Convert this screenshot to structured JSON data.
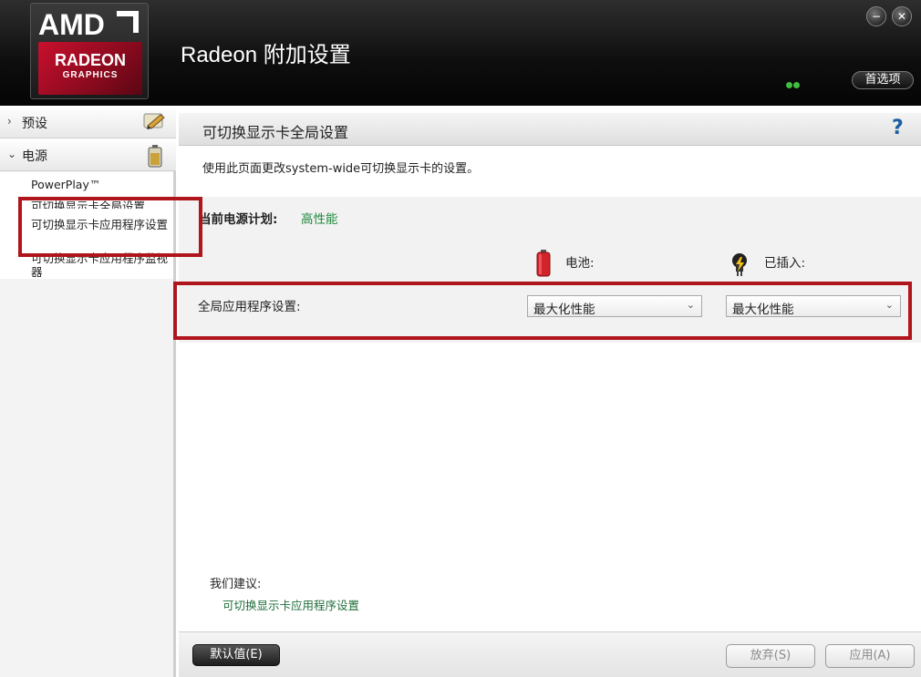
{
  "header": {
    "logo": {
      "brand": "AMD",
      "product": "RADEON",
      "sub": "GRAPHICS"
    },
    "title": "Radeon 附加设置",
    "window_controls": {
      "minimize": "−",
      "close": "✕"
    },
    "preferences_label": "首选项"
  },
  "sidebar": {
    "preset": {
      "label": "预设",
      "chevron": "›",
      "icon": "pencil-icon"
    },
    "power": {
      "label": "电源",
      "chevron": "⌄",
      "icon": "battery-icon"
    },
    "items": [
      {
        "label": "PowerPlay™"
      },
      {
        "label": "可切换显示卡全局设置"
      },
      {
        "label": "可切换显示卡应用程序设置"
      },
      {
        "label": "可切换显示卡应用程序监视器"
      }
    ]
  },
  "main": {
    "title": "可切换显示卡全局设置",
    "help_symbol": "?",
    "description": "使用此页面更改system-wide可切换显示卡的设置。",
    "power_plan": {
      "label": "当前电源计划:",
      "value": "高性能"
    },
    "columns": {
      "battery": "电池:",
      "plugged_in": "已插入:"
    },
    "global_app_setting": {
      "label": "全局应用程序设置:",
      "battery_value": "最大化性能",
      "plugged_value": "最大化性能"
    },
    "suggestions": {
      "title": "我们建议:",
      "link": "可切换显示卡应用程序设置"
    }
  },
  "footer": {
    "default_button": "默认值(E)",
    "discard_button": "放弃(S)",
    "apply_button": "应用(A)"
  },
  "colors": {
    "accent_red": "#b0151b",
    "plan_green": "#1f8a3c",
    "help_blue": "#1a5fa0"
  }
}
